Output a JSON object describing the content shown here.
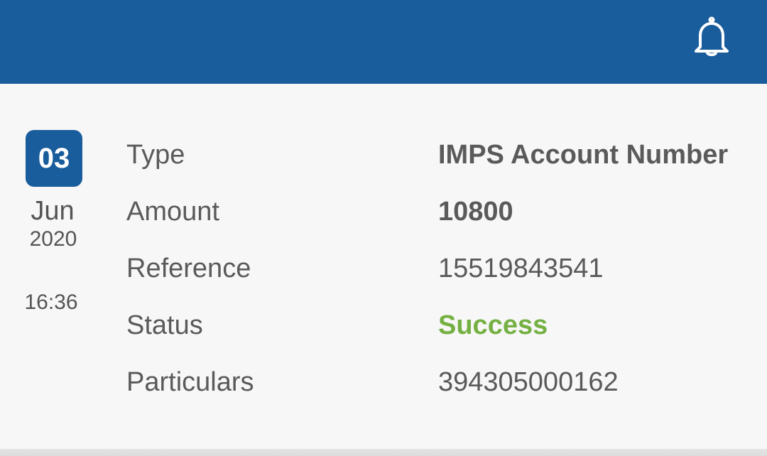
{
  "header": {
    "notification_icon": "bell-icon",
    "background_color": "#1a5d9c"
  },
  "transaction": {
    "date": {
      "day": "03",
      "month": "Jun",
      "year": "2020",
      "time": "16:36"
    },
    "rows": [
      {
        "label": "Type",
        "value": "IMPS Account Number"
      },
      {
        "label": "Amount",
        "value": "10800"
      },
      {
        "label": "Reference",
        "value": "15519843541"
      },
      {
        "label": "Status",
        "value": "Success"
      },
      {
        "label": "Particulars",
        "value": "394305000162"
      }
    ],
    "status_color": "#75b043"
  }
}
